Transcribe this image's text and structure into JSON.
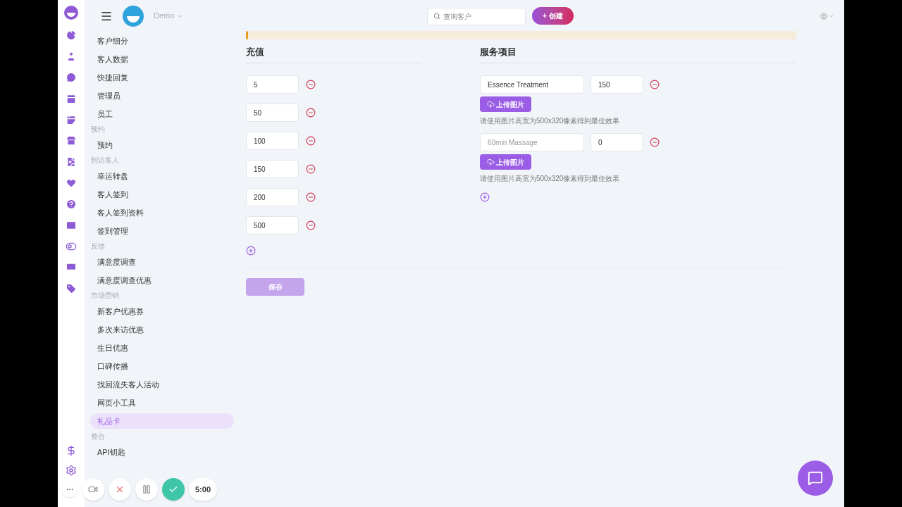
{
  "header": {
    "brand": "Demo",
    "search": {
      "placeholder": "查询客户"
    },
    "create_button": "+ 创建"
  },
  "sidebar": {
    "sections": [
      {
        "items": [
          {
            "label": "客户细分",
            "selected": false
          },
          {
            "label": "客人数据",
            "selected": false
          },
          {
            "label": "快捷回复",
            "selected": false
          },
          {
            "label": "管理员",
            "selected": false
          },
          {
            "label": "员工",
            "selected": false
          }
        ]
      },
      {
        "title": "预约",
        "items": [
          {
            "label": "预约",
            "selected": false
          }
        ]
      },
      {
        "title": "到访客人",
        "items": [
          {
            "label": "幸运转盘",
            "selected": false
          },
          {
            "label": "客人签到",
            "selected": false
          },
          {
            "label": "客人签到资料",
            "selected": false
          },
          {
            "label": "签到管理",
            "selected": false
          }
        ]
      },
      {
        "title": "反馈",
        "items": [
          {
            "label": "满意度调查",
            "selected": false
          },
          {
            "label": "满意度调查优惠",
            "selected": false
          }
        ]
      },
      {
        "title": "市场营销",
        "items": [
          {
            "label": "新客户优惠券",
            "selected": false
          },
          {
            "label": "多次来访优惠",
            "selected": false
          },
          {
            "label": "生日优惠",
            "selected": false
          },
          {
            "label": "口碑传播",
            "selected": false
          },
          {
            "label": "找回流失客人活动",
            "selected": false
          },
          {
            "label": "网页小工具",
            "selected": false
          },
          {
            "label": "礼品卡",
            "selected": true
          }
        ]
      },
      {
        "title": "整合",
        "items": [
          {
            "label": "API钥匙",
            "selected": false
          }
        ]
      }
    ]
  },
  "recharge": {
    "title": "充值",
    "amounts": [
      "5",
      "50",
      "100",
      "150",
      "200",
      "500"
    ]
  },
  "services": {
    "title": "服务项目",
    "items": [
      {
        "name": "Essence Treatment",
        "price": "150",
        "upload_button": "上传图片",
        "hint": "请使用图片高宽为500x320像素得到最佳效果"
      },
      {
        "placeholder": "60min Massage",
        "price": "0",
        "upload_button": "上传图片",
        "hint": "请使用图片高宽为500x320像素得到最佳效果"
      }
    ]
  },
  "save_button": {
    "label": "保存",
    "disabled": true
  },
  "recorder": {
    "timer": "5:00"
  }
}
